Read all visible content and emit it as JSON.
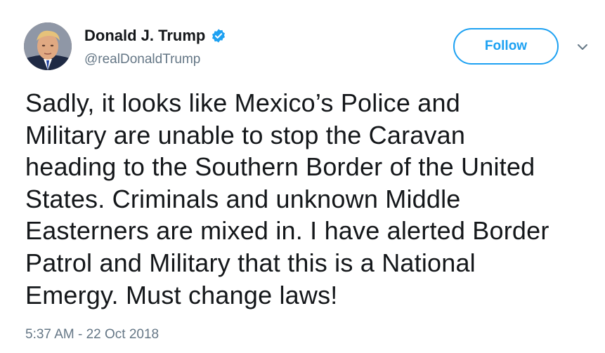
{
  "user": {
    "name": "Donald J. Trump",
    "handle": "@realDonaldTrump",
    "verified": true
  },
  "actions": {
    "follow_label": "Follow"
  },
  "tweet": {
    "lines": [
      "Sadly, it looks like Mexico’s Police and",
      "Military are unable to stop the Caravan",
      "heading to the Southern Border of the United",
      "States. Criminals and unknown Middle",
      "Easterners are mixed in. I have alerted Border",
      "Patrol and Military that this is a National",
      "Emergy. Must change laws!"
    ],
    "timestamp": "5:37 AM - 22 Oct 2018"
  },
  "colors": {
    "accent": "#1da1f2",
    "text": "#14171a",
    "secondary": "#657786"
  },
  "icons": {
    "verified": "verified-badge-icon",
    "more": "chevron-down-icon"
  }
}
